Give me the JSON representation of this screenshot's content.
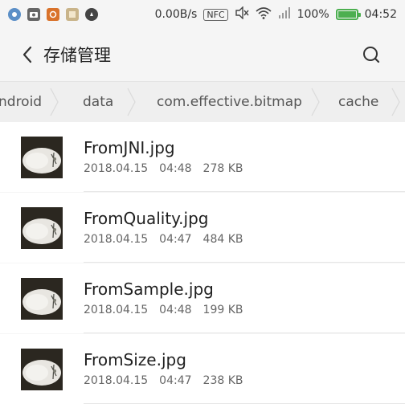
{
  "status": {
    "speed": "0.00B/s",
    "nfc": "NFC",
    "battery_pct": "100%",
    "time": "04:52",
    "battery_level": 1.0,
    "colors": {
      "battery": "#4caf50"
    }
  },
  "header": {
    "title": "存储管理"
  },
  "breadcrumb": [
    "ndroid",
    "data",
    "com.effective.bitmap",
    "cache"
  ],
  "files": [
    {
      "name": "FromJNI.jpg",
      "date": "2018.04.15",
      "time": "04:48",
      "size": "278 KB"
    },
    {
      "name": "FromQuality.jpg",
      "date": "2018.04.15",
      "time": "04:47",
      "size": "484 KB"
    },
    {
      "name": "FromSample.jpg",
      "date": "2018.04.15",
      "time": "04:48",
      "size": "199 KB"
    },
    {
      "name": "FromSize.jpg",
      "date": "2018.04.15",
      "time": "04:47",
      "size": "238 KB"
    }
  ],
  "icons": {
    "back": "chevron-left-icon",
    "search": "search-icon",
    "wifi": "wifi-icon",
    "mute": "mute-icon",
    "signal": "signal-icon"
  }
}
